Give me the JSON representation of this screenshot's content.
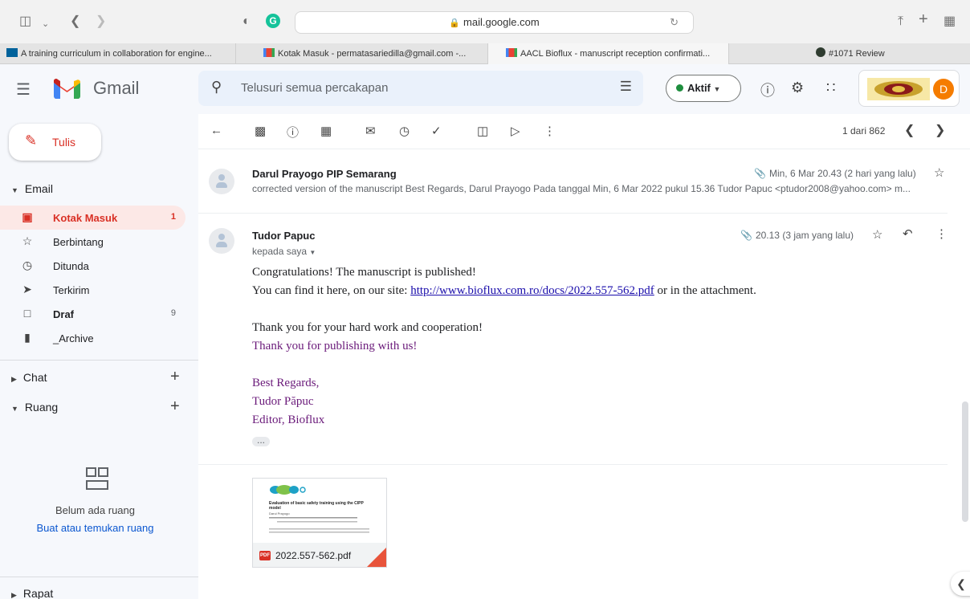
{
  "browser": {
    "url": "mail.google.com",
    "tabs": [
      {
        "label": "A training curriculum in collaboration for engine..."
      },
      {
        "label": "Kotak Masuk - permatasariedilla@gmail.com -..."
      },
      {
        "label": "AACL Bioflux - manuscript reception confirmati..."
      },
      {
        "label": "#1071 Review"
      }
    ]
  },
  "header": {
    "app_name": "Gmail",
    "search_placeholder": "Telusuri semua percakapan",
    "status_label": "Aktif",
    "avatar_letter": "D"
  },
  "sidebar": {
    "compose_label": "Tulis",
    "email_section": "Email",
    "items": [
      {
        "label": "Kotak Masuk",
        "count": "1"
      },
      {
        "label": "Berbintang",
        "count": ""
      },
      {
        "label": "Ditunda",
        "count": ""
      },
      {
        "label": "Terkirim",
        "count": ""
      },
      {
        "label": "Draf",
        "count": "9"
      },
      {
        "label": "_Archive",
        "count": ""
      }
    ],
    "chat_section": "Chat",
    "spaces_section": "Ruang",
    "empty_spaces_text": "Belum ada ruang",
    "find_spaces_link": "Buat atau temukan ruang",
    "meet_section": "Rapat"
  },
  "toolbar": {
    "pager_text": "1 dari 862"
  },
  "thread": {
    "collapsed": {
      "sender": "Darul Prayogo PIP Semarang",
      "date": "Min, 6 Mar 20.43 (2 hari yang lalu)",
      "snippet": "corrected version of the manuscript Best Regards, Darul Prayogo Pada tanggal Min, 6 Mar 2022 pukul 15.36 Tudor Papuc <ptudor2008@yahoo.com> m..."
    },
    "open": {
      "sender": "Tudor Papuc",
      "recipient": "kepada saya",
      "date": "20.13 (3 jam yang lalu)",
      "line1": "Congratulations! The manuscript is published!",
      "line2_prefix": "You can find it here, on our site: ",
      "line2_link": "http://www.bioflux.com.ro/docs/2022.557-562.pdf",
      "line2_suffix": " or in the attachment.",
      "line3": "Thank you for your hard work and cooperation!",
      "line4": "Thank you for publishing with us!",
      "sig1": "Best Regards,",
      "sig2": "Tudor Păpuc",
      "sig3": "Editor, Bioflux",
      "attachment": {
        "filename": "2022.557-562.pdf",
        "preview_title": "Evaluation of basic safety training using the CIPP model",
        "preview_author": "Darul Prayogo"
      }
    }
  },
  "colors": {
    "accent_red": "#d93025",
    "selected_bg": "#fce8e6",
    "signature_purple": "#6a1a7a",
    "link_blue": "#1a0dab",
    "avatar_orange": "#f57c00"
  }
}
